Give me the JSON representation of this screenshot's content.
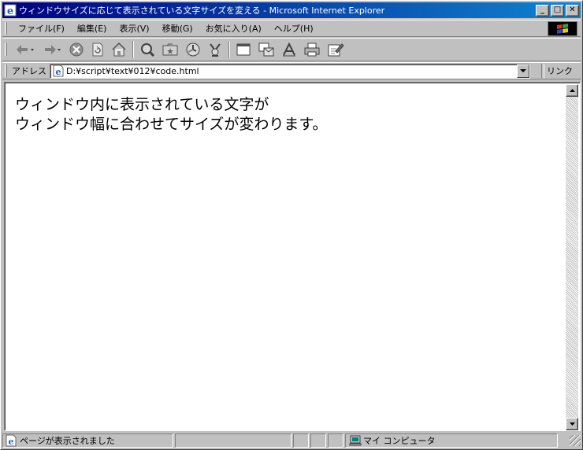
{
  "window": {
    "title": "ウィンドウサイズに応じて表示されている文字サイズを変える - Microsoft Internet Explorer",
    "minimize_label": "_",
    "maximize_label": "□",
    "close_label": "✕"
  },
  "menubar": {
    "items": [
      {
        "label": "ファイル(F)"
      },
      {
        "label": "編集(E)"
      },
      {
        "label": "表示(V)"
      },
      {
        "label": "移動(G)"
      },
      {
        "label": "お気に入り(A)"
      },
      {
        "label": "ヘルプ(H)"
      }
    ]
  },
  "toolbar": {
    "buttons": [
      {
        "icon": "back-arrow-icon"
      },
      {
        "icon": "forward-arrow-icon"
      },
      {
        "icon": "stop-icon"
      },
      {
        "icon": "refresh-icon"
      },
      {
        "icon": "home-icon"
      },
      {
        "icon": "search-icon"
      },
      {
        "icon": "favorites-icon"
      },
      {
        "icon": "history-icon"
      },
      {
        "icon": "channels-icon"
      },
      {
        "icon": "fullscreen-icon"
      },
      {
        "icon": "mail-icon"
      },
      {
        "icon": "fonts-icon"
      },
      {
        "icon": "print-icon"
      },
      {
        "icon": "edit-icon"
      }
    ]
  },
  "addressbar": {
    "label": "アドレス",
    "value": "D:¥script¥text¥012¥code.html",
    "links_label": "リンク"
  },
  "content": {
    "line1": "ウィンドウ内に表示されている文字が",
    "line2": "ウィンドウ幅に合わせてサイズが変わります。"
  },
  "statusbar": {
    "status_text": "ページが表示されました",
    "zone_text": "マイ コンピュータ"
  },
  "colors": {
    "titlebar_start": "#000080",
    "titlebar_end": "#1084d0",
    "chrome": "#c0c0c0"
  }
}
